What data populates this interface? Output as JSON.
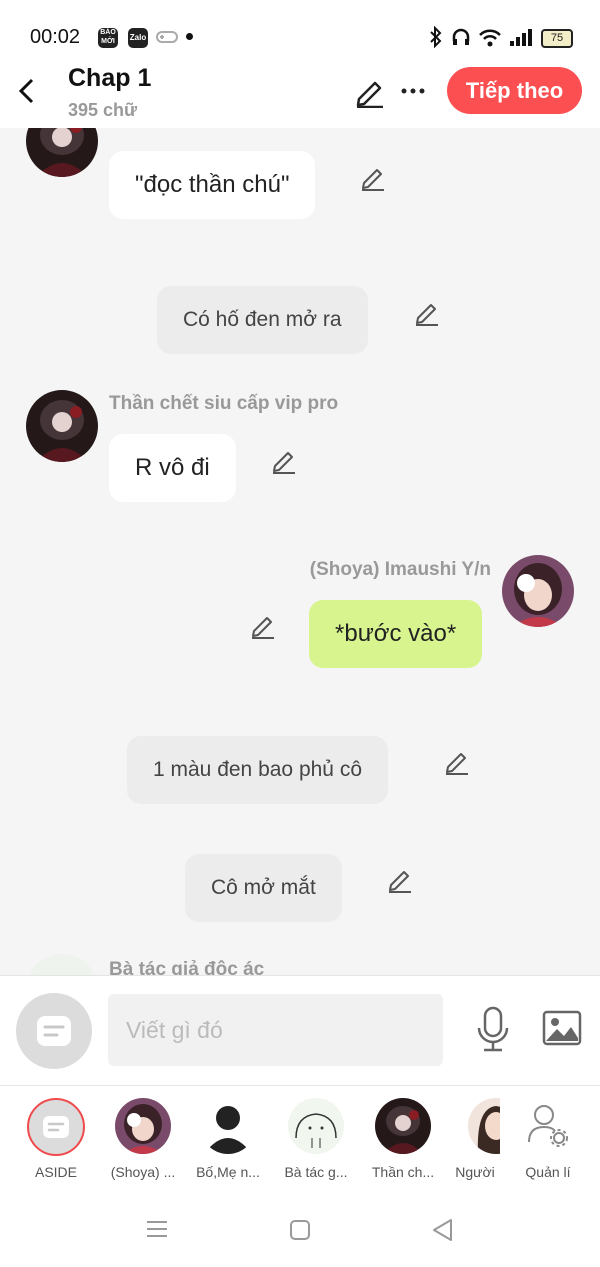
{
  "status_bar": {
    "time": "00:02",
    "app_icons": [
      "BÁO MỚI",
      "Zalo"
    ],
    "battery": "75"
  },
  "header": {
    "title": "Chap 1",
    "word_count": "395 chữ",
    "next_label": "Tiếp theo"
  },
  "chat": {
    "messages": [
      {
        "type": "left",
        "text": "\"đọc thần chú\""
      },
      {
        "type": "narration",
        "text": "Có hố đen mở ra"
      },
      {
        "type": "left",
        "sender": "Thần chết siu cấp vip pro",
        "text": "R vô đi"
      },
      {
        "type": "right",
        "sender": "(Shoya) Imaushi Y/n",
        "text": "*bước vào*"
      },
      {
        "type": "narration",
        "text": "1 màu đen bao phủ cô"
      },
      {
        "type": "narration",
        "text": "Cô mở mắt"
      },
      {
        "type": "left",
        "sender": "Bà tác giả độc ác"
      }
    ]
  },
  "input": {
    "placeholder": "Viết gì đó"
  },
  "characters": [
    {
      "name": "ASIDE"
    },
    {
      "name": "(Shoya) ..."
    },
    {
      "name": "Bố,Mẹ n..."
    },
    {
      "name": "Bà tác g..."
    },
    {
      "name": "Thần ch..."
    },
    {
      "name": "Người"
    },
    {
      "name": "Quản lí"
    }
  ],
  "colors": {
    "accent": "#fb4f52",
    "own_bubble": "#d8f48e",
    "narration_bubble": "#ececec",
    "background": "#f5f5f5"
  }
}
